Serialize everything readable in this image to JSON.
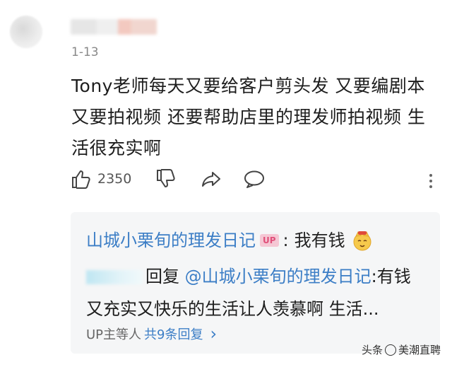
{
  "comment": {
    "date": "1-13",
    "text": "Tony老师每天又要给客户剪头发 又要编剧本 又要拍视频 还要帮助店里的理发师拍视频 生活很充实啊",
    "like_count": "2350"
  },
  "reply": {
    "author": "山城小栗旬的理发日记",
    "badge": "UP",
    "separator": ":",
    "text": "我有钱",
    "reply_word": "回复",
    "mention": "@山城小栗旬的理发日记",
    "reply_text": ":有钱又充实又快乐的生活让人羡慕啊 生活...",
    "footer_prefix": "UP主等人",
    "footer_link": "共9条回复",
    "footer_chevron": "›"
  },
  "watermark": {
    "left": "头条",
    "right": "美潮直聘"
  },
  "colors": {
    "link": "#3c7ec6",
    "up_badge_bg": "#f5c7d4",
    "up_badge_text": "#e0507a",
    "reply_bg": "#f5f6f7"
  },
  "icons": [
    "thumbs-up-icon",
    "thumbs-down-icon",
    "share-icon",
    "comment-icon",
    "more-icon",
    "emoji-icon"
  ]
}
